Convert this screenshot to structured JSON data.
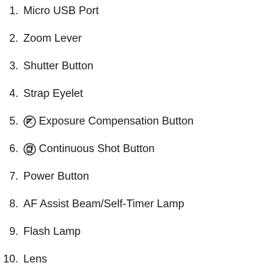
{
  "parts": [
    {
      "number": "1.",
      "label": "Micro USB Port",
      "icon": null
    },
    {
      "number": "2.",
      "label": "Zoom Lever",
      "icon": null
    },
    {
      "number": "3.",
      "label": "Shutter Button",
      "icon": null
    },
    {
      "number": "4.",
      "label": "Strap Eyelet",
      "icon": null
    },
    {
      "number": "5.",
      "label": "Exposure Compensation Button",
      "icon": "exposure-compensation-icon"
    },
    {
      "number": "6.",
      "label": "Continuous Shot Button",
      "icon": "continuous-shot-icon"
    },
    {
      "number": "7.",
      "label": "Power Button",
      "icon": null
    },
    {
      "number": "8.",
      "label": "AF Assist Beam/Self-Timer Lamp",
      "icon": null
    },
    {
      "number": "9.",
      "label": "Flash Lamp",
      "icon": null
    },
    {
      "number": "10.",
      "label": "Lens",
      "icon": null
    }
  ],
  "colors": {
    "text": "#1a1a1a"
  }
}
